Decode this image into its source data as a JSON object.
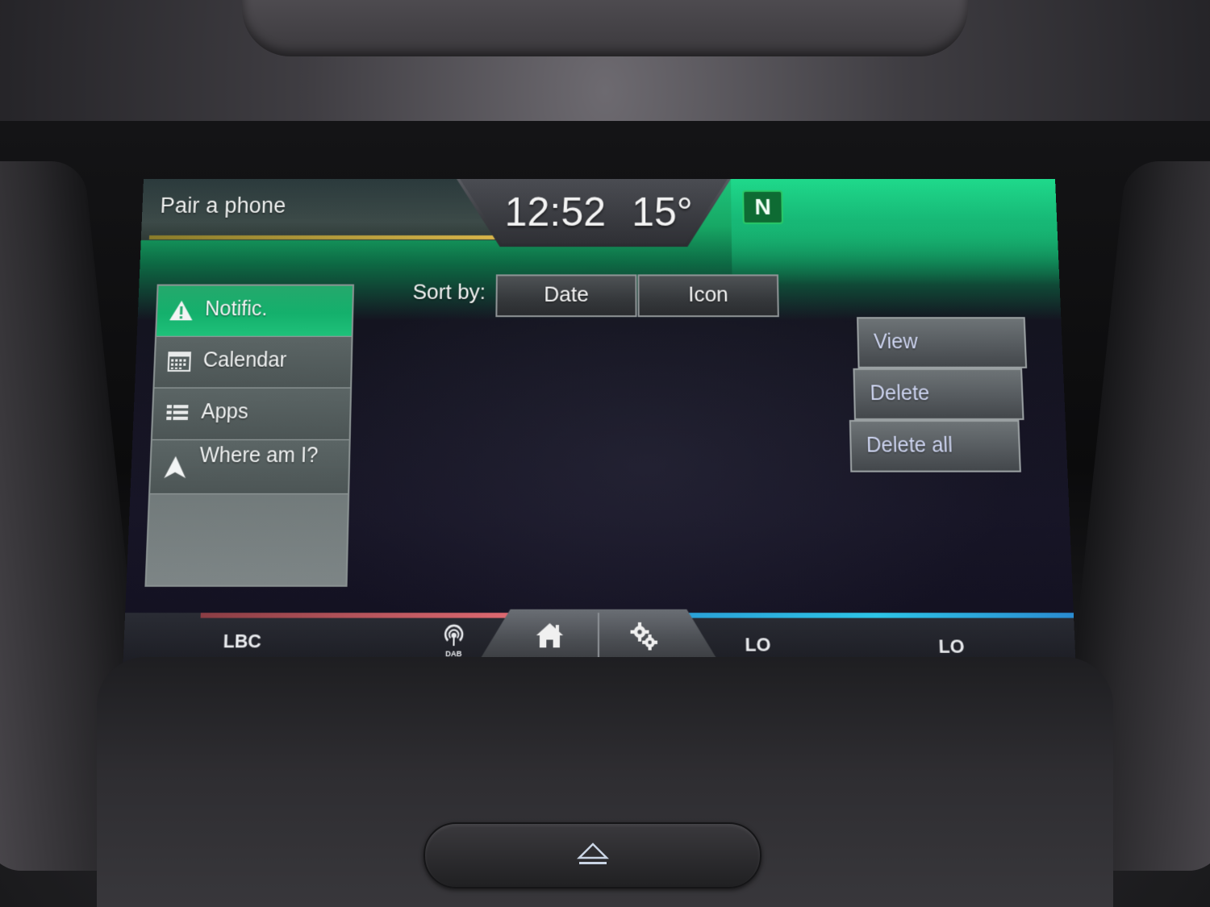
{
  "header": {
    "phone_status": "Pair a phone",
    "time": "12:52",
    "temperature": "15°",
    "compass": "N"
  },
  "sidebar": {
    "items": [
      {
        "label": "Notific.",
        "icon": "warning-icon",
        "active": true
      },
      {
        "label": "Calendar",
        "icon": "calendar-icon",
        "active": false
      },
      {
        "label": "Apps",
        "icon": "apps-list-icon",
        "active": false
      },
      {
        "label": "Where am I?",
        "icon": "navigation-arrow-icon",
        "active": false
      }
    ]
  },
  "sort": {
    "label": "Sort by:",
    "options": [
      "Date",
      "Icon"
    ]
  },
  "actions": {
    "view": "View",
    "delete": "Delete",
    "delete_all": "Delete all"
  },
  "bottom_bar": {
    "audio_source": "LBC",
    "dab_label": "DAB",
    "left_temp": "LO",
    "right_temp": "LO",
    "home_icon": "home-icon",
    "settings_icon": "gear-icon"
  },
  "colors": {
    "accent_green": "#1fc17a",
    "audio_red": "#e06a72",
    "climate_blue": "#2dc4e6",
    "phone_yellow": "#d9b64a"
  }
}
